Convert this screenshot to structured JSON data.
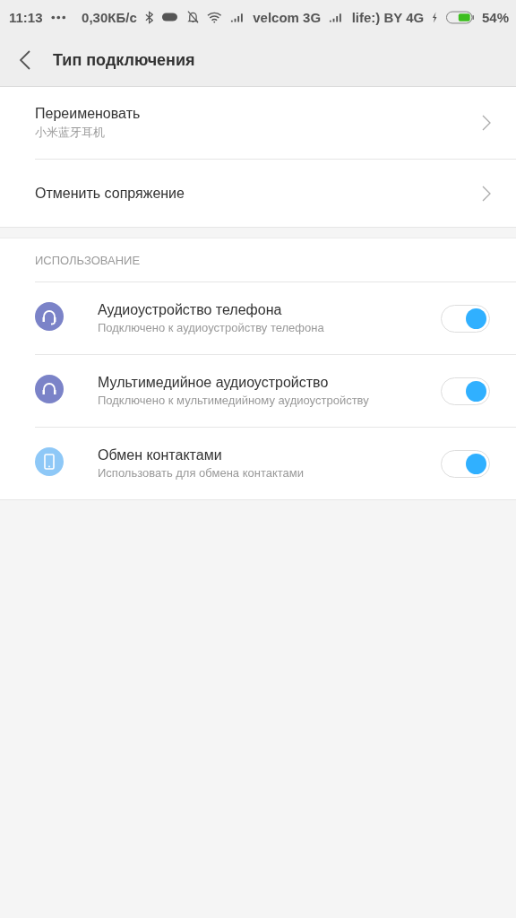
{
  "status_bar": {
    "time": "11:13",
    "speed": "0,30КБ/с",
    "carrier_1": "velcom 3G",
    "carrier_2": "life:) BY 4G",
    "battery": "54%"
  },
  "header": {
    "title": "Тип подключения"
  },
  "actions": [
    {
      "label": "Переименовать",
      "value": "小米蓝牙耳机"
    },
    {
      "label": "Отменить сопряжение"
    }
  ],
  "usage": {
    "heading": "ИСПОЛЬЗОВАНИЕ",
    "items": [
      {
        "kind": "headset",
        "title": "Аудиоустройство телефона",
        "subtitle": "Подключено к аудиоустройству телефона",
        "on": true
      },
      {
        "kind": "headphones",
        "title": "Мультимедийное аудиоустройство",
        "subtitle": "Подключено к мультимедийному аудиоустройству",
        "on": true
      },
      {
        "kind": "phone",
        "title": "Обмен контактами",
        "subtitle": "Использовать для обмена контактами",
        "on": true
      }
    ]
  }
}
